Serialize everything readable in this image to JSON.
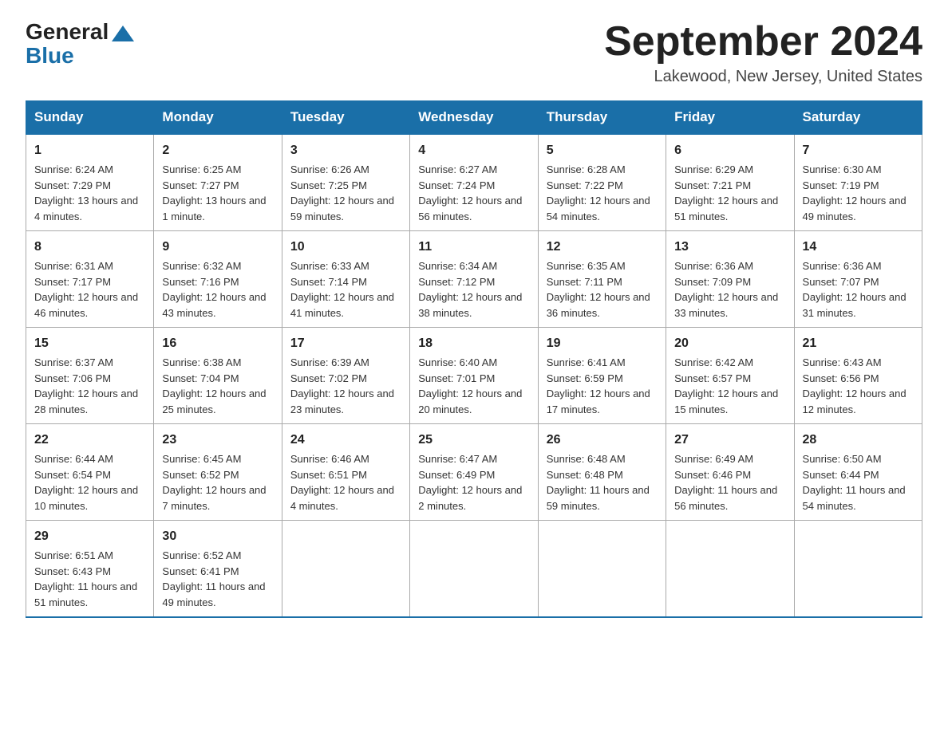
{
  "header": {
    "logo_general": "General",
    "logo_blue": "Blue",
    "month_title": "September 2024",
    "location": "Lakewood, New Jersey, United States"
  },
  "weekdays": [
    "Sunday",
    "Monday",
    "Tuesday",
    "Wednesday",
    "Thursday",
    "Friday",
    "Saturday"
  ],
  "weeks": [
    [
      {
        "day": "1",
        "sunrise": "6:24 AM",
        "sunset": "7:29 PM",
        "daylight": "13 hours and 4 minutes."
      },
      {
        "day": "2",
        "sunrise": "6:25 AM",
        "sunset": "7:27 PM",
        "daylight": "13 hours and 1 minute."
      },
      {
        "day": "3",
        "sunrise": "6:26 AM",
        "sunset": "7:25 PM",
        "daylight": "12 hours and 59 minutes."
      },
      {
        "day": "4",
        "sunrise": "6:27 AM",
        "sunset": "7:24 PM",
        "daylight": "12 hours and 56 minutes."
      },
      {
        "day": "5",
        "sunrise": "6:28 AM",
        "sunset": "7:22 PM",
        "daylight": "12 hours and 54 minutes."
      },
      {
        "day": "6",
        "sunrise": "6:29 AM",
        "sunset": "7:21 PM",
        "daylight": "12 hours and 51 minutes."
      },
      {
        "day": "7",
        "sunrise": "6:30 AM",
        "sunset": "7:19 PM",
        "daylight": "12 hours and 49 minutes."
      }
    ],
    [
      {
        "day": "8",
        "sunrise": "6:31 AM",
        "sunset": "7:17 PM",
        "daylight": "12 hours and 46 minutes."
      },
      {
        "day": "9",
        "sunrise": "6:32 AM",
        "sunset": "7:16 PM",
        "daylight": "12 hours and 43 minutes."
      },
      {
        "day": "10",
        "sunrise": "6:33 AM",
        "sunset": "7:14 PM",
        "daylight": "12 hours and 41 minutes."
      },
      {
        "day": "11",
        "sunrise": "6:34 AM",
        "sunset": "7:12 PM",
        "daylight": "12 hours and 38 minutes."
      },
      {
        "day": "12",
        "sunrise": "6:35 AM",
        "sunset": "7:11 PM",
        "daylight": "12 hours and 36 minutes."
      },
      {
        "day": "13",
        "sunrise": "6:36 AM",
        "sunset": "7:09 PM",
        "daylight": "12 hours and 33 minutes."
      },
      {
        "day": "14",
        "sunrise": "6:36 AM",
        "sunset": "7:07 PM",
        "daylight": "12 hours and 31 minutes."
      }
    ],
    [
      {
        "day": "15",
        "sunrise": "6:37 AM",
        "sunset": "7:06 PM",
        "daylight": "12 hours and 28 minutes."
      },
      {
        "day": "16",
        "sunrise": "6:38 AM",
        "sunset": "7:04 PM",
        "daylight": "12 hours and 25 minutes."
      },
      {
        "day": "17",
        "sunrise": "6:39 AM",
        "sunset": "7:02 PM",
        "daylight": "12 hours and 23 minutes."
      },
      {
        "day": "18",
        "sunrise": "6:40 AM",
        "sunset": "7:01 PM",
        "daylight": "12 hours and 20 minutes."
      },
      {
        "day": "19",
        "sunrise": "6:41 AM",
        "sunset": "6:59 PM",
        "daylight": "12 hours and 17 minutes."
      },
      {
        "day": "20",
        "sunrise": "6:42 AM",
        "sunset": "6:57 PM",
        "daylight": "12 hours and 15 minutes."
      },
      {
        "day": "21",
        "sunrise": "6:43 AM",
        "sunset": "6:56 PM",
        "daylight": "12 hours and 12 minutes."
      }
    ],
    [
      {
        "day": "22",
        "sunrise": "6:44 AM",
        "sunset": "6:54 PM",
        "daylight": "12 hours and 10 minutes."
      },
      {
        "day": "23",
        "sunrise": "6:45 AM",
        "sunset": "6:52 PM",
        "daylight": "12 hours and 7 minutes."
      },
      {
        "day": "24",
        "sunrise": "6:46 AM",
        "sunset": "6:51 PM",
        "daylight": "12 hours and 4 minutes."
      },
      {
        "day": "25",
        "sunrise": "6:47 AM",
        "sunset": "6:49 PM",
        "daylight": "12 hours and 2 minutes."
      },
      {
        "day": "26",
        "sunrise": "6:48 AM",
        "sunset": "6:48 PM",
        "daylight": "11 hours and 59 minutes."
      },
      {
        "day": "27",
        "sunrise": "6:49 AM",
        "sunset": "6:46 PM",
        "daylight": "11 hours and 56 minutes."
      },
      {
        "day": "28",
        "sunrise": "6:50 AM",
        "sunset": "6:44 PM",
        "daylight": "11 hours and 54 minutes."
      }
    ],
    [
      {
        "day": "29",
        "sunrise": "6:51 AM",
        "sunset": "6:43 PM",
        "daylight": "11 hours and 51 minutes."
      },
      {
        "day": "30",
        "sunrise": "6:52 AM",
        "sunset": "6:41 PM",
        "daylight": "11 hours and 49 minutes."
      },
      null,
      null,
      null,
      null,
      null
    ]
  ]
}
